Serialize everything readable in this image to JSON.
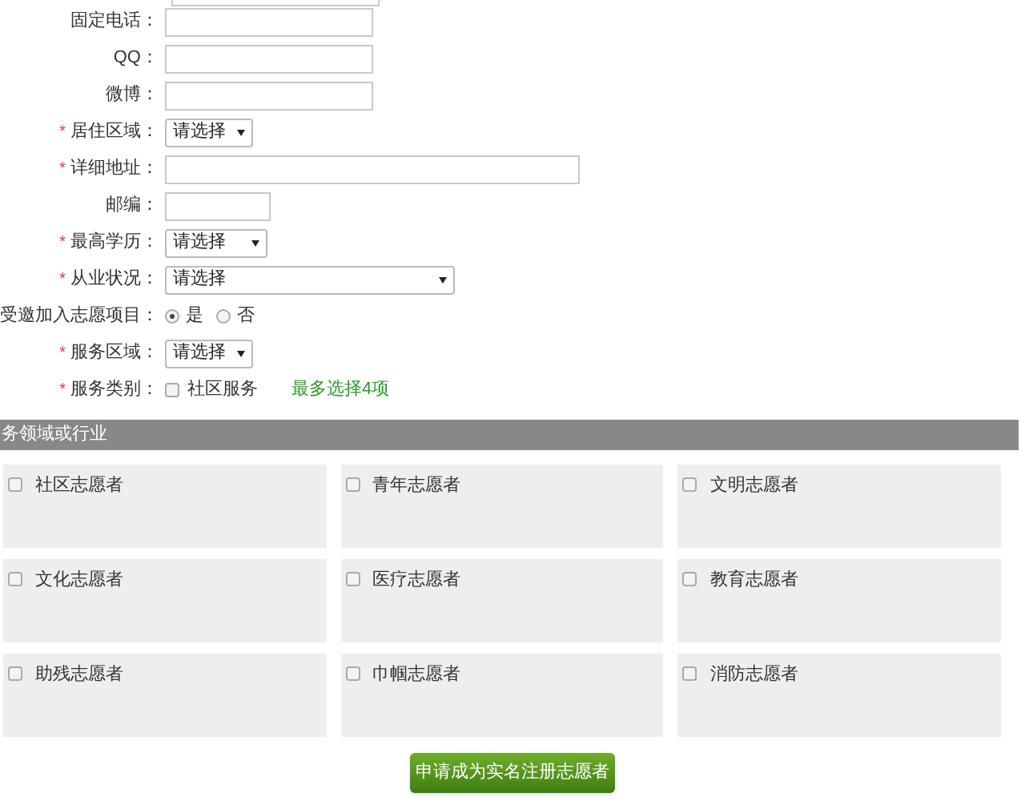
{
  "form": {
    "rows": [
      {
        "kind": "text",
        "label": "固定电话："
      },
      {
        "kind": "text",
        "label": "QQ："
      },
      {
        "kind": "text",
        "label": "微博："
      },
      {
        "kind": "select",
        "label": "居住区域：",
        "required_mark": "*",
        "value": "请选择"
      },
      {
        "kind": "text",
        "label": "详细地址：",
        "required_mark": "*"
      },
      {
        "kind": "text",
        "label": "邮编："
      },
      {
        "kind": "select",
        "label": "最高学历：",
        "required_mark": "*",
        "value": "请选择"
      },
      {
        "kind": "select",
        "label": "从业状况：",
        "required_mark": "*",
        "value": "请选择"
      },
      {
        "kind": "radio",
        "label": "受邀加入志愿项目：",
        "options": [
          {
            "label": "是",
            "selected": true
          },
          {
            "label": "否",
            "selected": false
          }
        ]
      },
      {
        "kind": "select",
        "label": "服务区域：",
        "required_mark": "*",
        "value": "请选择"
      },
      {
        "kind": "checkbox",
        "label": "服务类别：",
        "required_mark": "*",
        "options": [
          {
            "label": "社区服务",
            "checked": false
          }
        ],
        "hint": "最多选择4项"
      }
    ]
  },
  "section": {
    "title": "务领域或行业",
    "items": [
      {
        "label": "社区志愿者",
        "checked": false
      },
      {
        "label": "青年志愿者",
        "checked": false
      },
      {
        "label": "文明志愿者",
        "checked": false
      },
      {
        "label": "文化志愿者",
        "checked": false
      },
      {
        "label": "医疗志愿者",
        "checked": false
      },
      {
        "label": "教育志愿者",
        "checked": false
      },
      {
        "label": "助残志愿者",
        "checked": false
      },
      {
        "label": "巾帼志愿者",
        "checked": false
      },
      {
        "label": "消防志愿者",
        "checked": false
      }
    ]
  },
  "submit": "申请成为实名注册志愿者"
}
